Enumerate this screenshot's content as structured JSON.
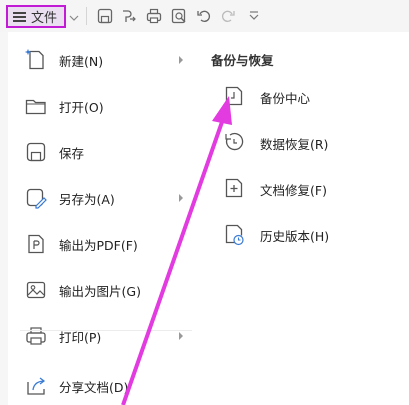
{
  "toolbar": {
    "file_label": "文件",
    "icons": [
      "menu-icon",
      "chevron-down-icon",
      "save-icon",
      "export-icon",
      "print-icon",
      "print-preview-icon",
      "undo-icon",
      "redo-icon",
      "more-dropdown-icon"
    ]
  },
  "menu": {
    "items": [
      {
        "label": "新建(N)",
        "icon": "new-file-icon",
        "has_submenu": true
      },
      {
        "label": "打开(O)",
        "icon": "open-folder-icon",
        "has_submenu": false
      },
      {
        "label": "保存",
        "icon": "save-icon",
        "has_submenu": false
      },
      {
        "label": "另存为(A)",
        "icon": "save-as-icon",
        "has_submenu": true
      },
      {
        "label": "输出为PDF(F)",
        "icon": "pdf-icon",
        "has_submenu": false
      },
      {
        "label": "输出为图片(G)",
        "icon": "image-icon",
        "has_submenu": false
      },
      {
        "label": "打印(P)",
        "icon": "print-icon",
        "has_submenu": true
      },
      {
        "label": "分享文档(D)",
        "icon": "share-icon",
        "has_submenu": false
      }
    ]
  },
  "submenu": {
    "title": "备份与恢复",
    "items": [
      {
        "label": "备份中心",
        "icon": "backup-center-icon"
      },
      {
        "label": "数据恢复(R)",
        "icon": "data-recovery-icon"
      },
      {
        "label": "文档修复(F)",
        "icon": "document-repair-icon"
      },
      {
        "label": "历史版本(H)",
        "icon": "history-version-icon"
      }
    ]
  },
  "colors": {
    "highlight_border": "#c21bd6",
    "annotation_arrow": "#e23be0",
    "menu_bg": "#ffffff"
  }
}
